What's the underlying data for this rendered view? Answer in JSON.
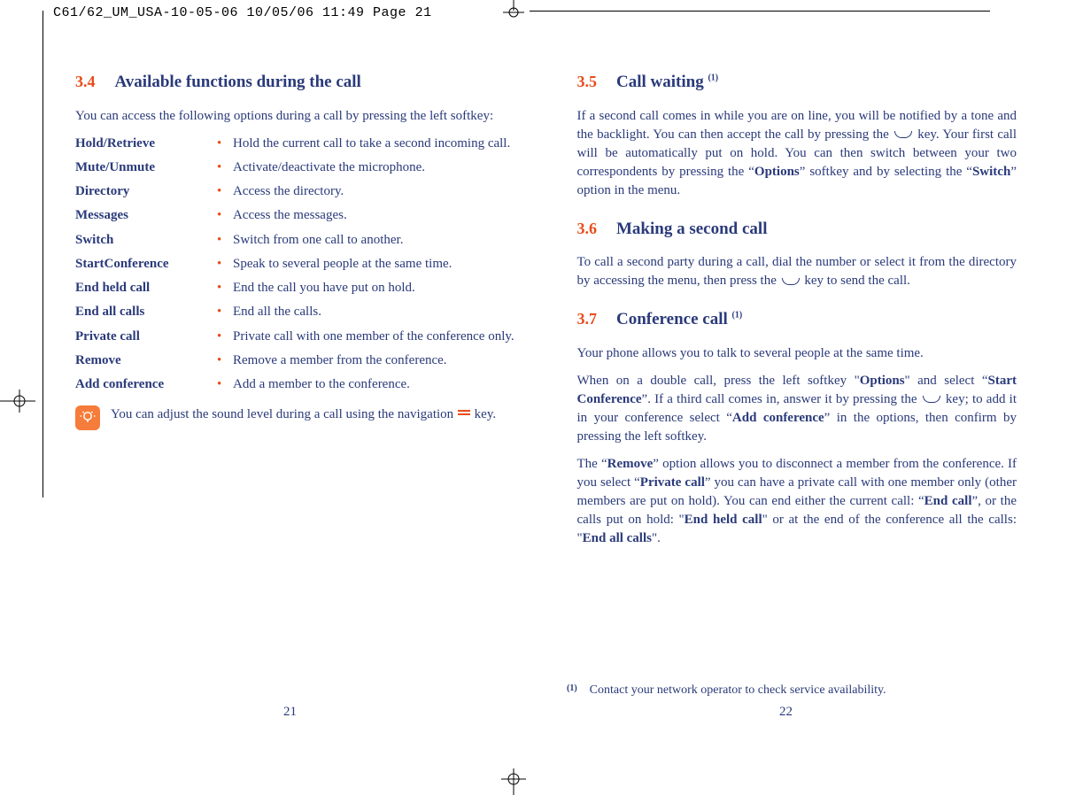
{
  "print_header": "C61/62_UM_USA-10-05-06  10/05/06  11:49  Page 21",
  "left": {
    "s34": {
      "num": "3.4",
      "title": "Available functions during the call",
      "intro": "You can access the following options during a call by pressing the left softkey:",
      "functions": [
        {
          "label": "Hold/Retrieve",
          "desc": "Hold the current call to take a second incoming call."
        },
        {
          "label": "Mute/Unmute",
          "desc": "Activate/deactivate the microphone."
        },
        {
          "label": "Directory",
          "desc": "Access the directory."
        },
        {
          "label": "Messages",
          "desc": "Access the messages."
        },
        {
          "label": "Switch",
          "desc": "Switch from one call to another."
        },
        {
          "label": "StartConference",
          "desc": "Speak to several people at the same time."
        },
        {
          "label": "End held call",
          "desc": "End the call you have put on hold."
        },
        {
          "label": "End all calls",
          "desc": "End all the calls."
        },
        {
          "label": "Private call",
          "desc": "Private call with one member of the conference only."
        },
        {
          "label": "Remove",
          "desc": "Remove a member from the conference."
        },
        {
          "label": "Add conference",
          "desc": "Add a member to the conference."
        }
      ],
      "tip_a": "You can adjust the sound level during a call using the navigation ",
      "tip_b": " key."
    },
    "page": "21"
  },
  "right": {
    "s35": {
      "num": "3.5",
      "title": "Call waiting ",
      "sup": "(1)",
      "p1a": "If a second call comes in while you are on line, you will be notified by a tone and the backlight. You can then accept the call by pressing the ",
      "p1b": " key. Your first call will be automatically put on hold. You can then switch between your two correspondents by pressing the “",
      "p1c": "Options",
      "p1d": "” softkey and by selecting the “",
      "p1e": "Switch",
      "p1f": "” option in the menu."
    },
    "s36": {
      "num": "3.6",
      "title": "Making a second call",
      "p1a": "To call a second party during a call, dial the number or select it from the directory by accessing the menu, then press the ",
      "p1b": " key to send the call."
    },
    "s37": {
      "num": "3.7",
      "title": "Conference call ",
      "sup": "(1)",
      "p1": "Your phone allows you to talk to several people at the same time.",
      "p2a": "When on a double call, press the left softkey \"",
      "p2b": "Options",
      "p2c": "\" and select “",
      "p2d": "Start Conference",
      "p2e": "”. If a third call comes in, answer it by pressing the ",
      "p2f": " key; to add it in your conference select “",
      "p2g": "Add conference",
      "p2h": "” in the options, then confirm by pressing the left softkey.",
      "p3a": "The “",
      "p3b": "Remove",
      "p3c": "” option allows you to disconnect a member from the conference. If you select “",
      "p3d": "Private call",
      "p3e": "” you can have a private call with one member only (other members are put on hold). You can end either the current call: “",
      "p3f": "End call",
      "p3g": "”, or the calls put on hold: \"",
      "p3h": "End held call",
      "p3i": "\" or at the end of the conference all the calls: \"",
      "p3j": "End all calls",
      "p3k": "\"."
    },
    "footnote_marker": "(1)",
    "footnote": "Contact your network operator to check service availability.",
    "page": "22"
  }
}
